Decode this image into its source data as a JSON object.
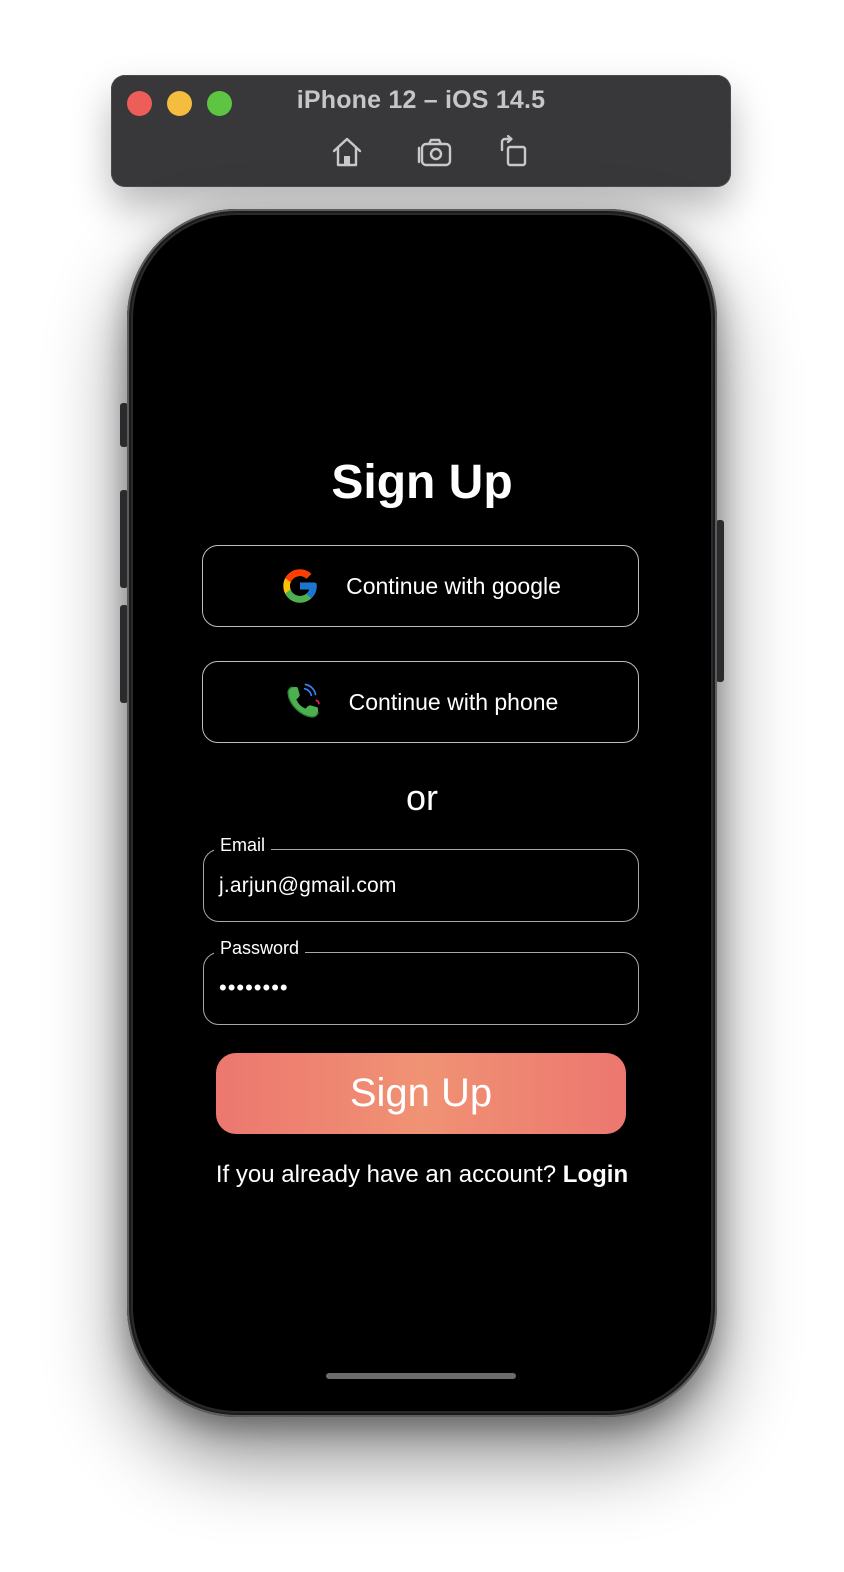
{
  "simulator": {
    "title": "iPhone 12 – iOS 14.5",
    "toolbar_icons": [
      "home-icon",
      "screenshot-icon",
      "rotate-icon"
    ],
    "traffic_light_colors": [
      "#ee5e58",
      "#f4bd40",
      "#5ec542"
    ]
  },
  "screen": {
    "title": "Sign Up",
    "google_button_label": "Continue with google",
    "phone_button_label": "Continue with phone",
    "divider_text": "or",
    "email": {
      "label": "Email",
      "value": "j.arjun@gmail.com"
    },
    "password": {
      "label": "Password",
      "masked_value": "••••••••"
    },
    "signup_button_label": "Sign Up",
    "login_prompt": "If you already have an account? ",
    "login_link": "Login"
  },
  "colors": {
    "background": "#000000",
    "button_gradient": [
      "#ec776f",
      "#f09274",
      "#ec776f"
    ],
    "text": "#ffffff"
  }
}
